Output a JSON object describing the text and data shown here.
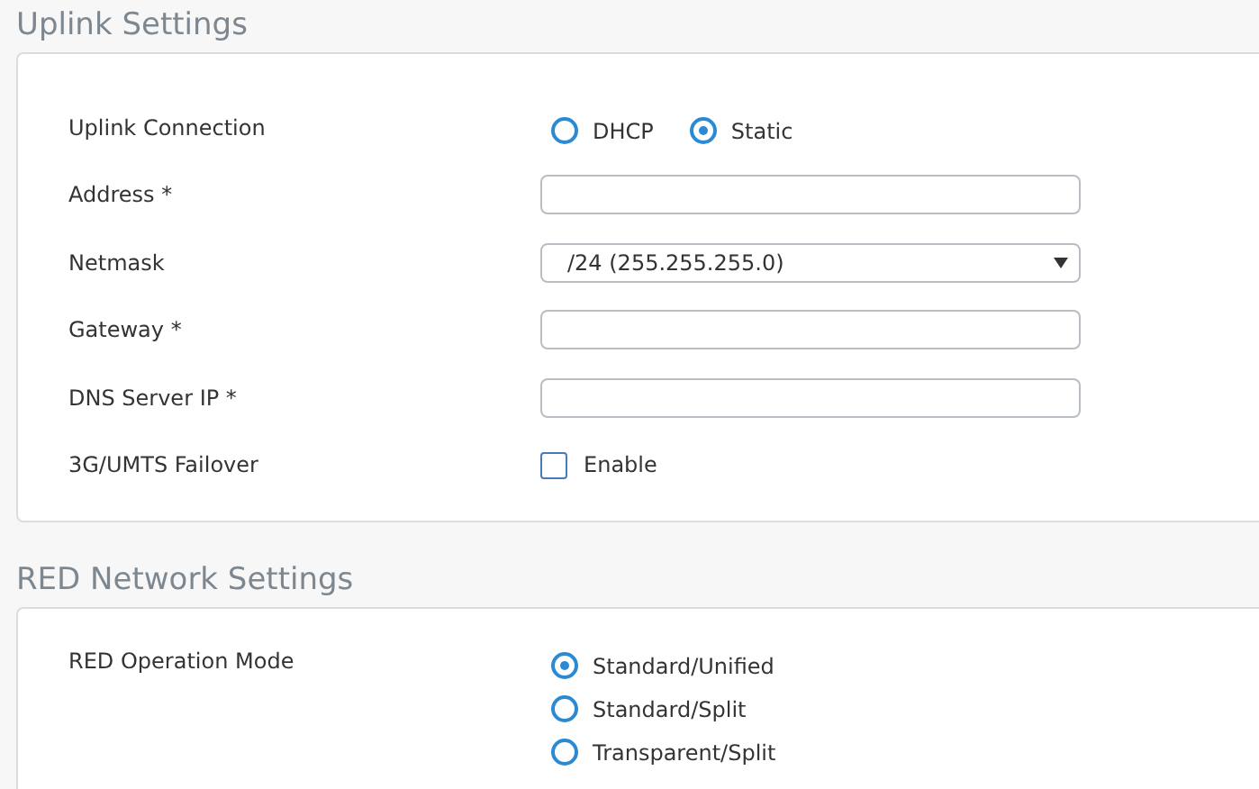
{
  "sections": [
    {
      "title": "Uplink Settings",
      "rows": [
        {
          "kind": "radio-inline",
          "label": "Uplink Connection",
          "options": [
            {
              "label": "DHCP",
              "selected": false
            },
            {
              "label": "Static",
              "selected": true
            }
          ]
        },
        {
          "kind": "text",
          "label": "Address *"
        },
        {
          "kind": "select",
          "label": "Netmask",
          "value": "/24 (255.255.255.0)"
        },
        {
          "kind": "text",
          "label": "Gateway *"
        },
        {
          "kind": "text",
          "label": "DNS Server IP *"
        },
        {
          "kind": "checkbox",
          "label": "3G/UMTS Failover",
          "option": "Enable",
          "checked": false
        }
      ]
    },
    {
      "title": "RED Network Settings",
      "rows": [
        {
          "kind": "radio-list",
          "label": "RED Operation Mode",
          "options": [
            {
              "label": "Standard/Unified",
              "selected": true
            },
            {
              "label": "Standard/Split",
              "selected": false
            },
            {
              "label": "Transparent/Split",
              "selected": false
            }
          ]
        }
      ]
    }
  ]
}
